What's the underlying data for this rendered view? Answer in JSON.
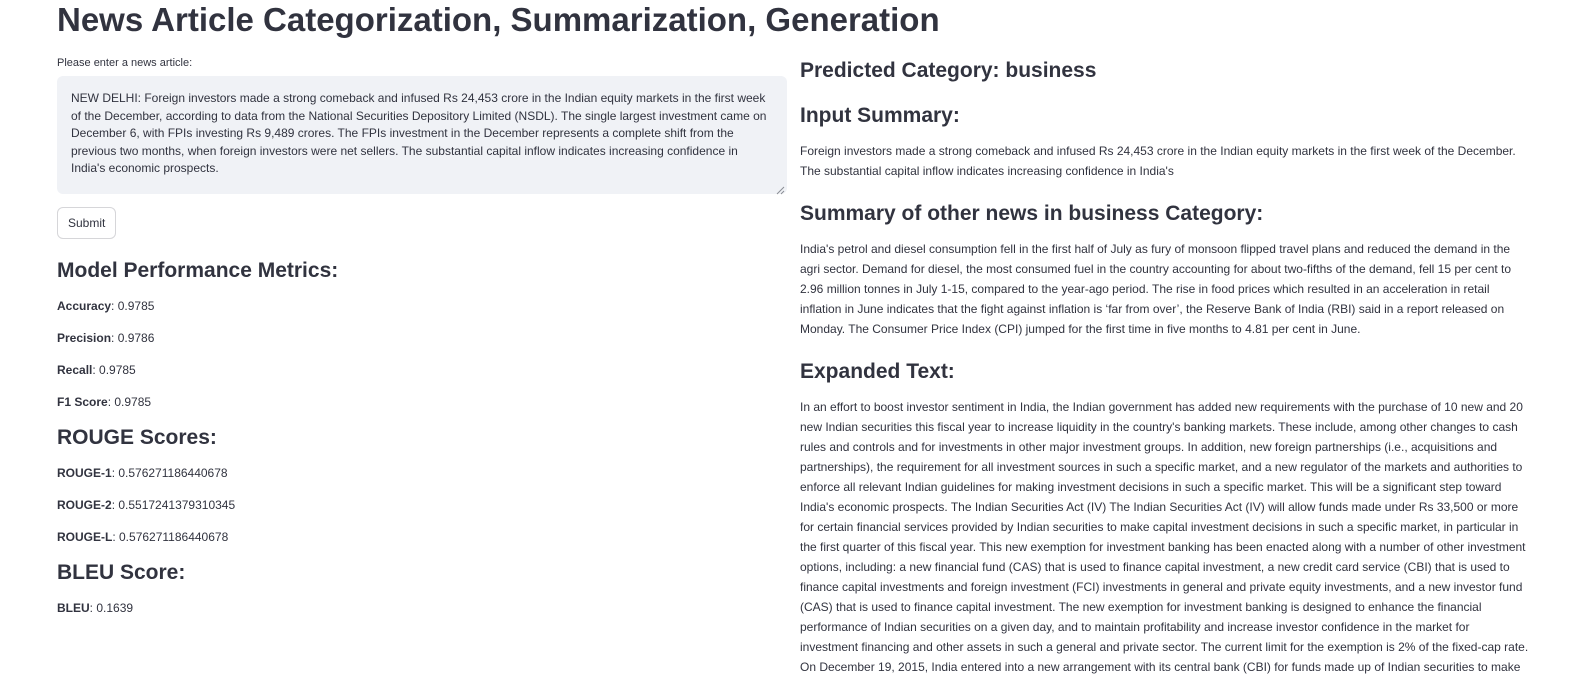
{
  "app": {
    "title": "News Article Categorization, Summarization, Generation"
  },
  "input": {
    "label": "Please enter a news article:",
    "value": "NEW DELHI: Foreign investors made a strong comeback and infused Rs 24,453 crore in the Indian equity markets in the first week of the December, according to data from the National Securities Depository Limited (NSDL). The single largest investment came on December 6, with FPIs investing Rs 9,489 crores. The FPIs investment in the December represents a complete shift from the previous two months, when foreign investors were net sellers. The substantial capital inflow indicates increasing confidence in India's economic prospects.",
    "submit_label": "Submit"
  },
  "metrics": {
    "heading": "Model Performance Metrics:",
    "items": [
      {
        "label": "Accuracy",
        "value": ": 0.9785"
      },
      {
        "label": "Precision",
        "value": ": 0.9786"
      },
      {
        "label": "Recall",
        "value": ": 0.9785"
      },
      {
        "label": "F1 Score",
        "value": ": 0.9785"
      }
    ]
  },
  "rouge": {
    "heading": "ROUGE Scores:",
    "items": [
      {
        "label": "ROUGE-1",
        "value": ": 0.576271186440678"
      },
      {
        "label": "ROUGE-2",
        "value": ": 0.5517241379310345"
      },
      {
        "label": "ROUGE-L",
        "value": ": 0.576271186440678"
      }
    ]
  },
  "bleu": {
    "heading": "BLEU Score:",
    "items": [
      {
        "label": "BLEU",
        "value": ": 0.1639"
      }
    ]
  },
  "results": {
    "predicted_category": "Predicted Category: business",
    "input_summary_heading": "Input Summary:",
    "input_summary": "Foreign investors made a strong comeback and infused Rs 24,453 crore in the Indian equity markets in the first week of the December. The substantial capital inflow indicates increasing confidence in India's",
    "other_news_heading": "Summary of other news in business Category:",
    "other_news": "India's petrol and diesel consumption fell in the first half of July as fury of monsoon flipped travel plans and reduced the demand in the agri sector. Demand for diesel, the most consumed fuel in the country accounting for about two-fifths of the demand, fell 15 per cent to 2.96 million tonnes in July 1-15, compared to the year-ago period. The rise in food prices which resulted in an acceleration in retail inflation in June indicates that the fight against inflation is ‘far from over’, the Reserve Bank of India (RBI) said in a report released on Monday. The Consumer Price Index (CPI) jumped for the first time in five months to 4.81 per cent in June.",
    "expanded_heading": "Expanded Text:",
    "expanded_text": "In an effort to boost investor sentiment in India, the Indian government has added new requirements with the purchase of 10 new and 20 new Indian securities this fiscal year to increase liquidity in the country's banking markets. These include, among other changes to cash rules and controls and for investments in other major investment groups. In addition, new foreign partnerships (i.e., acquisitions and partnerships), the requirement for all investment sources in such a specific market, and a new regulator of the markets and authorities to enforce all relevant Indian guidelines for making investment decisions in such a specific market. This will be a significant step toward India's economic prospects. The Indian Securities Act (IV) The Indian Securities Act (IV) will allow funds made under Rs 33,500 or more for certain financial services provided by Indian securities to make capital investment decisions in such a specific market, in particular in the first quarter of this fiscal year. This new exemption for investment banking has been enacted along with a number of other investment options, including: a new financial fund (CAS) that is used to finance capital investment, a new credit card service (CBI) that is used to finance capital investments and foreign investment (FCI) investments in general and private equity investments, and a new investor fund (CAS) that is used to finance capital investment. The new exemption for investment banking is designed to enhance the financial performance of Indian securities on a given day, and to maintain profitability and increase investor confidence in the market for investment financing and other assets in such a general and private sector. The current limit for the exemption is 2% of the fixed-cap rate. On December 19, 2015, India entered into a new arrangement with its central bank (CBI) for funds made up of Indian securities to make capital investments in particular."
  }
}
